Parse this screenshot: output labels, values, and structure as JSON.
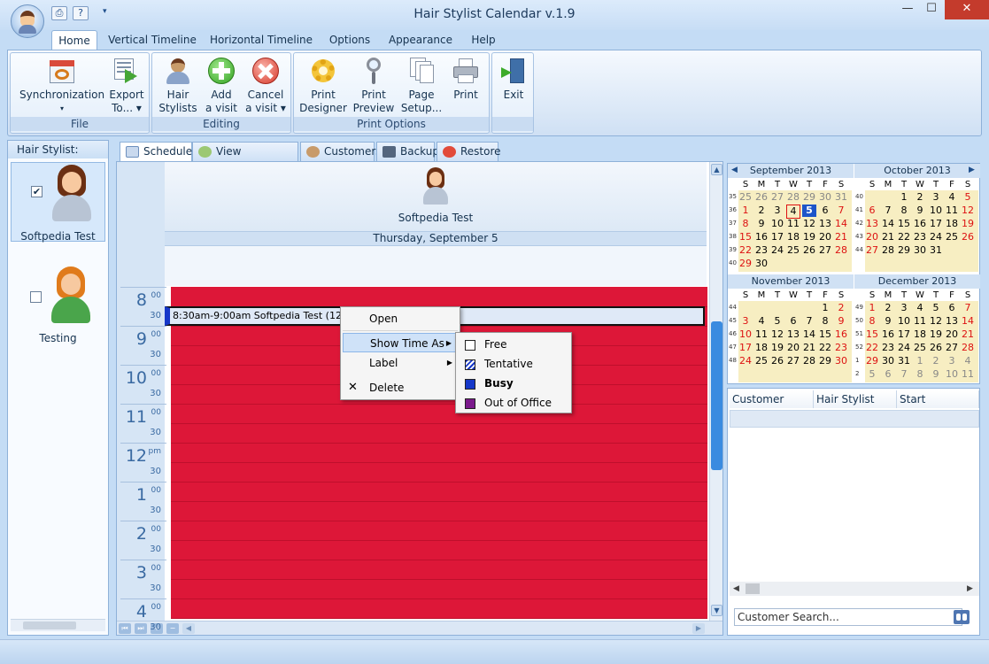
{
  "window": {
    "title": "Hair Stylist Calendar v.1.9"
  },
  "ribbon_tabs": [
    "Home",
    "Vertical Timeline",
    "Horizontal Timeline",
    "Options",
    "Appearance",
    "Help"
  ],
  "groups": {
    "file": "File",
    "editing": "Editing",
    "print": "Print Options"
  },
  "buttons": {
    "sync": "Synchronization",
    "export1": "Export",
    "export2": "To...",
    "hair1": "Hair",
    "hair2": "Stylists",
    "add1": "Add",
    "add2": "a visit",
    "cancel1": "Cancel",
    "cancel2": "a visit",
    "pdes1": "Print",
    "pdes2": "Designer",
    "pprev1": "Print",
    "pprev2": "Preview",
    "psetup1": "Page",
    "psetup2": "Setup...",
    "print": "Print",
    "exit": "Exit"
  },
  "stylist_panel": {
    "header": "Hair Stylist:",
    "stylists": [
      {
        "name": "Softpedia Test"
      },
      {
        "name": "Testing"
      }
    ]
  },
  "view_tabs": [
    "Scheduler",
    "View Reservations",
    "Customers",
    "Backup",
    "Restore"
  ],
  "scheduler": {
    "stylist": "Softpedia Test",
    "date": "Thursday, September 5",
    "hours": [
      {
        "h": "8",
        "m": "00"
      },
      {
        "h": "9",
        "m": "00"
      },
      {
        "h": "10",
        "m": "00"
      },
      {
        "h": "11",
        "m": "00"
      },
      {
        "h": "12",
        "m": "pm"
      },
      {
        "h": "1",
        "m": "00"
      },
      {
        "h": "2",
        "m": "00"
      },
      {
        "h": "3",
        "m": "00"
      },
      {
        "h": "4",
        "m": "00"
      }
    ],
    "half": "30",
    "appointment": "8:30am-9:00am Softpedia Test (123456"
  },
  "context_menu": {
    "open": "Open",
    "show_time_as": "Show Time As",
    "label": "Label",
    "delete": "Delete"
  },
  "submenu": {
    "free": "Free",
    "tentative": "Tentative",
    "busy": "Busy",
    "ooo": "Out of Office"
  },
  "calendar": {
    "dow": [
      "S",
      "M",
      "T",
      "W",
      "T",
      "F",
      "S"
    ],
    "months": [
      {
        "title": "September 2013",
        "weeks": [
          "35",
          "36",
          "37",
          "38",
          "39",
          "40"
        ],
        "days": [
          [
            "25",
            "26",
            "27",
            "28",
            "29",
            "30",
            "31"
          ],
          [
            "1",
            "2",
            "3",
            "4",
            "5",
            "6",
            "7"
          ],
          [
            "8",
            "9",
            "10",
            "11",
            "12",
            "13",
            "14"
          ],
          [
            "15",
            "16",
            "17",
            "18",
            "19",
            "20",
            "21"
          ],
          [
            "22",
            "23",
            "24",
            "25",
            "26",
            "27",
            "28"
          ],
          [
            "29",
            "30",
            "",
            "",
            "",
            "",
            ""
          ]
        ]
      },
      {
        "title": "October 2013",
        "weeks": [
          "40",
          "41",
          "42",
          "43",
          "44"
        ],
        "days": [
          [
            "",
            "",
            "1",
            "2",
            "3",
            "4",
            "5"
          ],
          [
            "6",
            "7",
            "8",
            "9",
            "10",
            "11",
            "12"
          ],
          [
            "13",
            "14",
            "15",
            "16",
            "17",
            "18",
            "19"
          ],
          [
            "20",
            "21",
            "22",
            "23",
            "24",
            "25",
            "26"
          ],
          [
            "27",
            "28",
            "29",
            "30",
            "31",
            "",
            ""
          ]
        ]
      },
      {
        "title": "November 2013",
        "weeks": [
          "44",
          "45",
          "46",
          "47",
          "48"
        ],
        "days": [
          [
            "",
            "",
            "",
            "",
            "",
            "1",
            "2"
          ],
          [
            "3",
            "4",
            "5",
            "6",
            "7",
            "8",
            "9"
          ],
          [
            "10",
            "11",
            "12",
            "13",
            "14",
            "15",
            "16"
          ],
          [
            "17",
            "18",
            "19",
            "20",
            "21",
            "22",
            "23"
          ],
          [
            "24",
            "25",
            "26",
            "27",
            "28",
            "29",
            "30"
          ]
        ]
      },
      {
        "title": "December 2013",
        "weeks": [
          "49",
          "50",
          "51",
          "52",
          "1",
          "2"
        ],
        "days": [
          [
            "1",
            "2",
            "3",
            "4",
            "5",
            "6",
            "7"
          ],
          [
            "8",
            "9",
            "10",
            "11",
            "12",
            "13",
            "14"
          ],
          [
            "15",
            "16",
            "17",
            "18",
            "19",
            "20",
            "21"
          ],
          [
            "22",
            "23",
            "24",
            "25",
            "26",
            "27",
            "28"
          ],
          [
            "29",
            "30",
            "31",
            "1",
            "2",
            "3",
            "4"
          ],
          [
            "5",
            "6",
            "7",
            "8",
            "9",
            "10",
            "11"
          ]
        ]
      }
    ]
  },
  "customers": {
    "columns": [
      "Customer",
      "Hair Stylist",
      "Start"
    ],
    "search_placeholder": "Customer Search..."
  },
  "colors": {
    "grid": "#dd1738",
    "busy": "#1638c9",
    "ooo": "#7b1a8c",
    "accent": "#3a8be0"
  }
}
